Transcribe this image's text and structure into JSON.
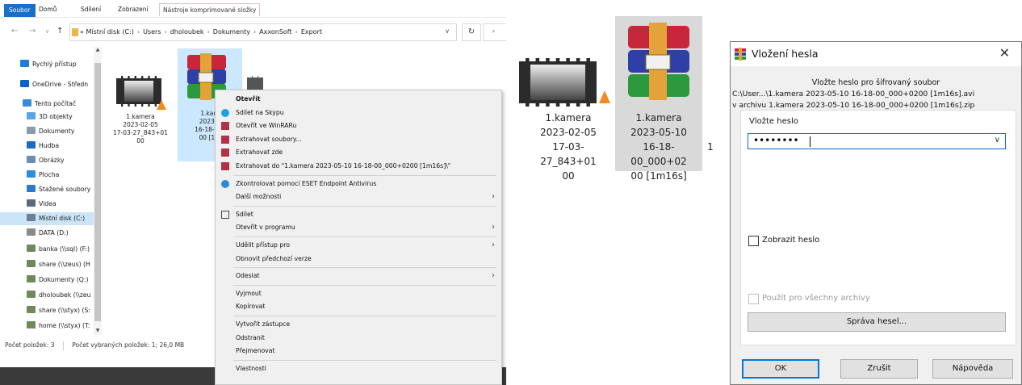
{
  "ribbon": {
    "tabs": [
      "Soubor",
      "Domů",
      "Sdílení",
      "Zobrazení",
      "Nástroje komprimované složky"
    ]
  },
  "address": {
    "crumbs": [
      "«",
      "Místní disk (C:)",
      "Users",
      "dholoubek",
      "Dokumenty",
      "AxxonSoft",
      "Export"
    ]
  },
  "nav": {
    "items": [
      {
        "label": "Rychlý přístup",
        "icon": "star-icon",
        "color": "#1e7bd8"
      },
      {
        "label": "OneDrive - Středn",
        "icon": "cloud-icon",
        "color": "#0a64c8"
      },
      {
        "label": "Tento počítač",
        "icon": "computer-icon",
        "color": "#3b8ad9"
      },
      {
        "label": "3D objekty",
        "icon": "cube-icon",
        "color": "#5aa5e6"
      },
      {
        "label": "Dokumenty",
        "icon": "document-icon",
        "color": "#8a9bb0"
      },
      {
        "label": "Hudba",
        "icon": "music-icon",
        "color": "#1b6bc4"
      },
      {
        "label": "Obrázky",
        "icon": "picture-icon",
        "color": "#6a8db5"
      },
      {
        "label": "Plocha",
        "icon": "desktop-icon",
        "color": "#2d8ce0"
      },
      {
        "label": "Stažené soubory",
        "icon": "download-icon",
        "color": "#2c7ad0"
      },
      {
        "label": "Videa",
        "icon": "video-icon",
        "color": "#5b6b7f"
      },
      {
        "label": "Místní disk (C:)",
        "icon": "drive-icon",
        "color": "#6d7f93"
      },
      {
        "label": "DATA (D:)",
        "icon": "drive-icon",
        "color": "#8a8a8a"
      },
      {
        "label": "banka (\\\\sql) (F:)",
        "icon": "network-drive-icon",
        "color": "#6f8a5a"
      },
      {
        "label": "share (\\\\zeus) (H",
        "icon": "network-drive-icon",
        "color": "#6f8a5a"
      },
      {
        "label": "Dokumenty (Q:)",
        "icon": "network-drive-icon",
        "color": "#6f8a5a"
      },
      {
        "label": "dholoubek (\\\\zeu",
        "icon": "network-drive-icon",
        "color": "#6f8a5a"
      },
      {
        "label": "share (\\\\styx) (S:",
        "icon": "network-drive-icon",
        "color": "#6f8a5a"
      },
      {
        "label": "home (\\\\styx) (T:",
        "icon": "network-drive-icon",
        "color": "#6f8a5a"
      }
    ]
  },
  "files": [
    {
      "lines": [
        "1.kamera",
        "2023-02-05",
        "17-03-27_843+01",
        "00"
      ],
      "kind": "video"
    },
    {
      "lines": [
        "1.kam",
        "2023-0",
        "16-18-00_",
        "00 [1m"
      ],
      "kind": "archive"
    }
  ],
  "status": {
    "count": "Počet položek: 3",
    "selected": "Počet vybraných položek: 1; 26,0 MB"
  },
  "context_menu": {
    "items": [
      {
        "label": "Otevřít",
        "bold": true
      },
      {
        "label": "Sdílet na Skypu",
        "icon": "skype-icon"
      },
      {
        "label": "Otevřít ve WinRARu",
        "icon": "winrar-icon"
      },
      {
        "label": "Extrahovat soubory...",
        "icon": "winrar-icon"
      },
      {
        "label": "Extrahovat zde",
        "icon": "winrar-icon"
      },
      {
        "label": "Extrahovat do \"1.kamera 2023-05-10 16-18-00_000+0200 [1m16s]\\\"",
        "icon": "winrar-icon"
      },
      {
        "sep": true
      },
      {
        "label": "Zkontrolovat pomocí ESET Endpoint Antivirus",
        "icon": "eset-icon"
      },
      {
        "label": "Další možnosti",
        "sub": true
      },
      {
        "sep": true
      },
      {
        "label": "Sdílet",
        "icon": "share-icon"
      },
      {
        "label": "Otevřít v programu",
        "sub": true
      },
      {
        "sep": true
      },
      {
        "label": "Udělit přístup pro",
        "sub": true
      },
      {
        "label": "Obnovit předchozí verze"
      },
      {
        "sep": true
      },
      {
        "label": "Odeslat",
        "sub": true
      },
      {
        "sep": true
      },
      {
        "label": "Vyjmout"
      },
      {
        "label": "Kopírovat"
      },
      {
        "sep": true
      },
      {
        "label": "Vytvořit zástupce"
      },
      {
        "label": "Odstranit"
      },
      {
        "label": "Přejmenovat"
      },
      {
        "sep": true
      },
      {
        "label": "Vlastnosti"
      }
    ]
  },
  "big_files": [
    {
      "lines": [
        "1.kamera",
        "2023-02-05",
        "17-03-27_843+01",
        "00"
      ]
    },
    {
      "lines": [
        "1.kamera",
        "2023-05-10",
        "16-18-00_000+02",
        "00 [1m16s]"
      ]
    },
    {
      "lines": [
        "1"
      ]
    }
  ],
  "dialog": {
    "title": "Vložení hesla",
    "prompt": "Vložte heslo pro šifrovaný soubor",
    "file_path": "C:\\User...\\1.kamera 2023-05-10 16-18-00_000+0200 [1m16s].avi",
    "archive": "v archivu 1.kamera 2023-05-10 16-18-00_000+0200 [1m16s].zip",
    "password_label": "Vložte heslo",
    "password_value": "••••••••",
    "show_password": "Zobrazit heslo",
    "use_for_all": "Použít pro všechny archivy",
    "manage_button": "Správa hesel...",
    "ok": "OK",
    "cancel": "Zrušit",
    "help": "Nápověda"
  },
  "colors": {
    "selection": "#cce8ff",
    "accent": "#0078d7",
    "file_tab": "#1a6fc9"
  }
}
